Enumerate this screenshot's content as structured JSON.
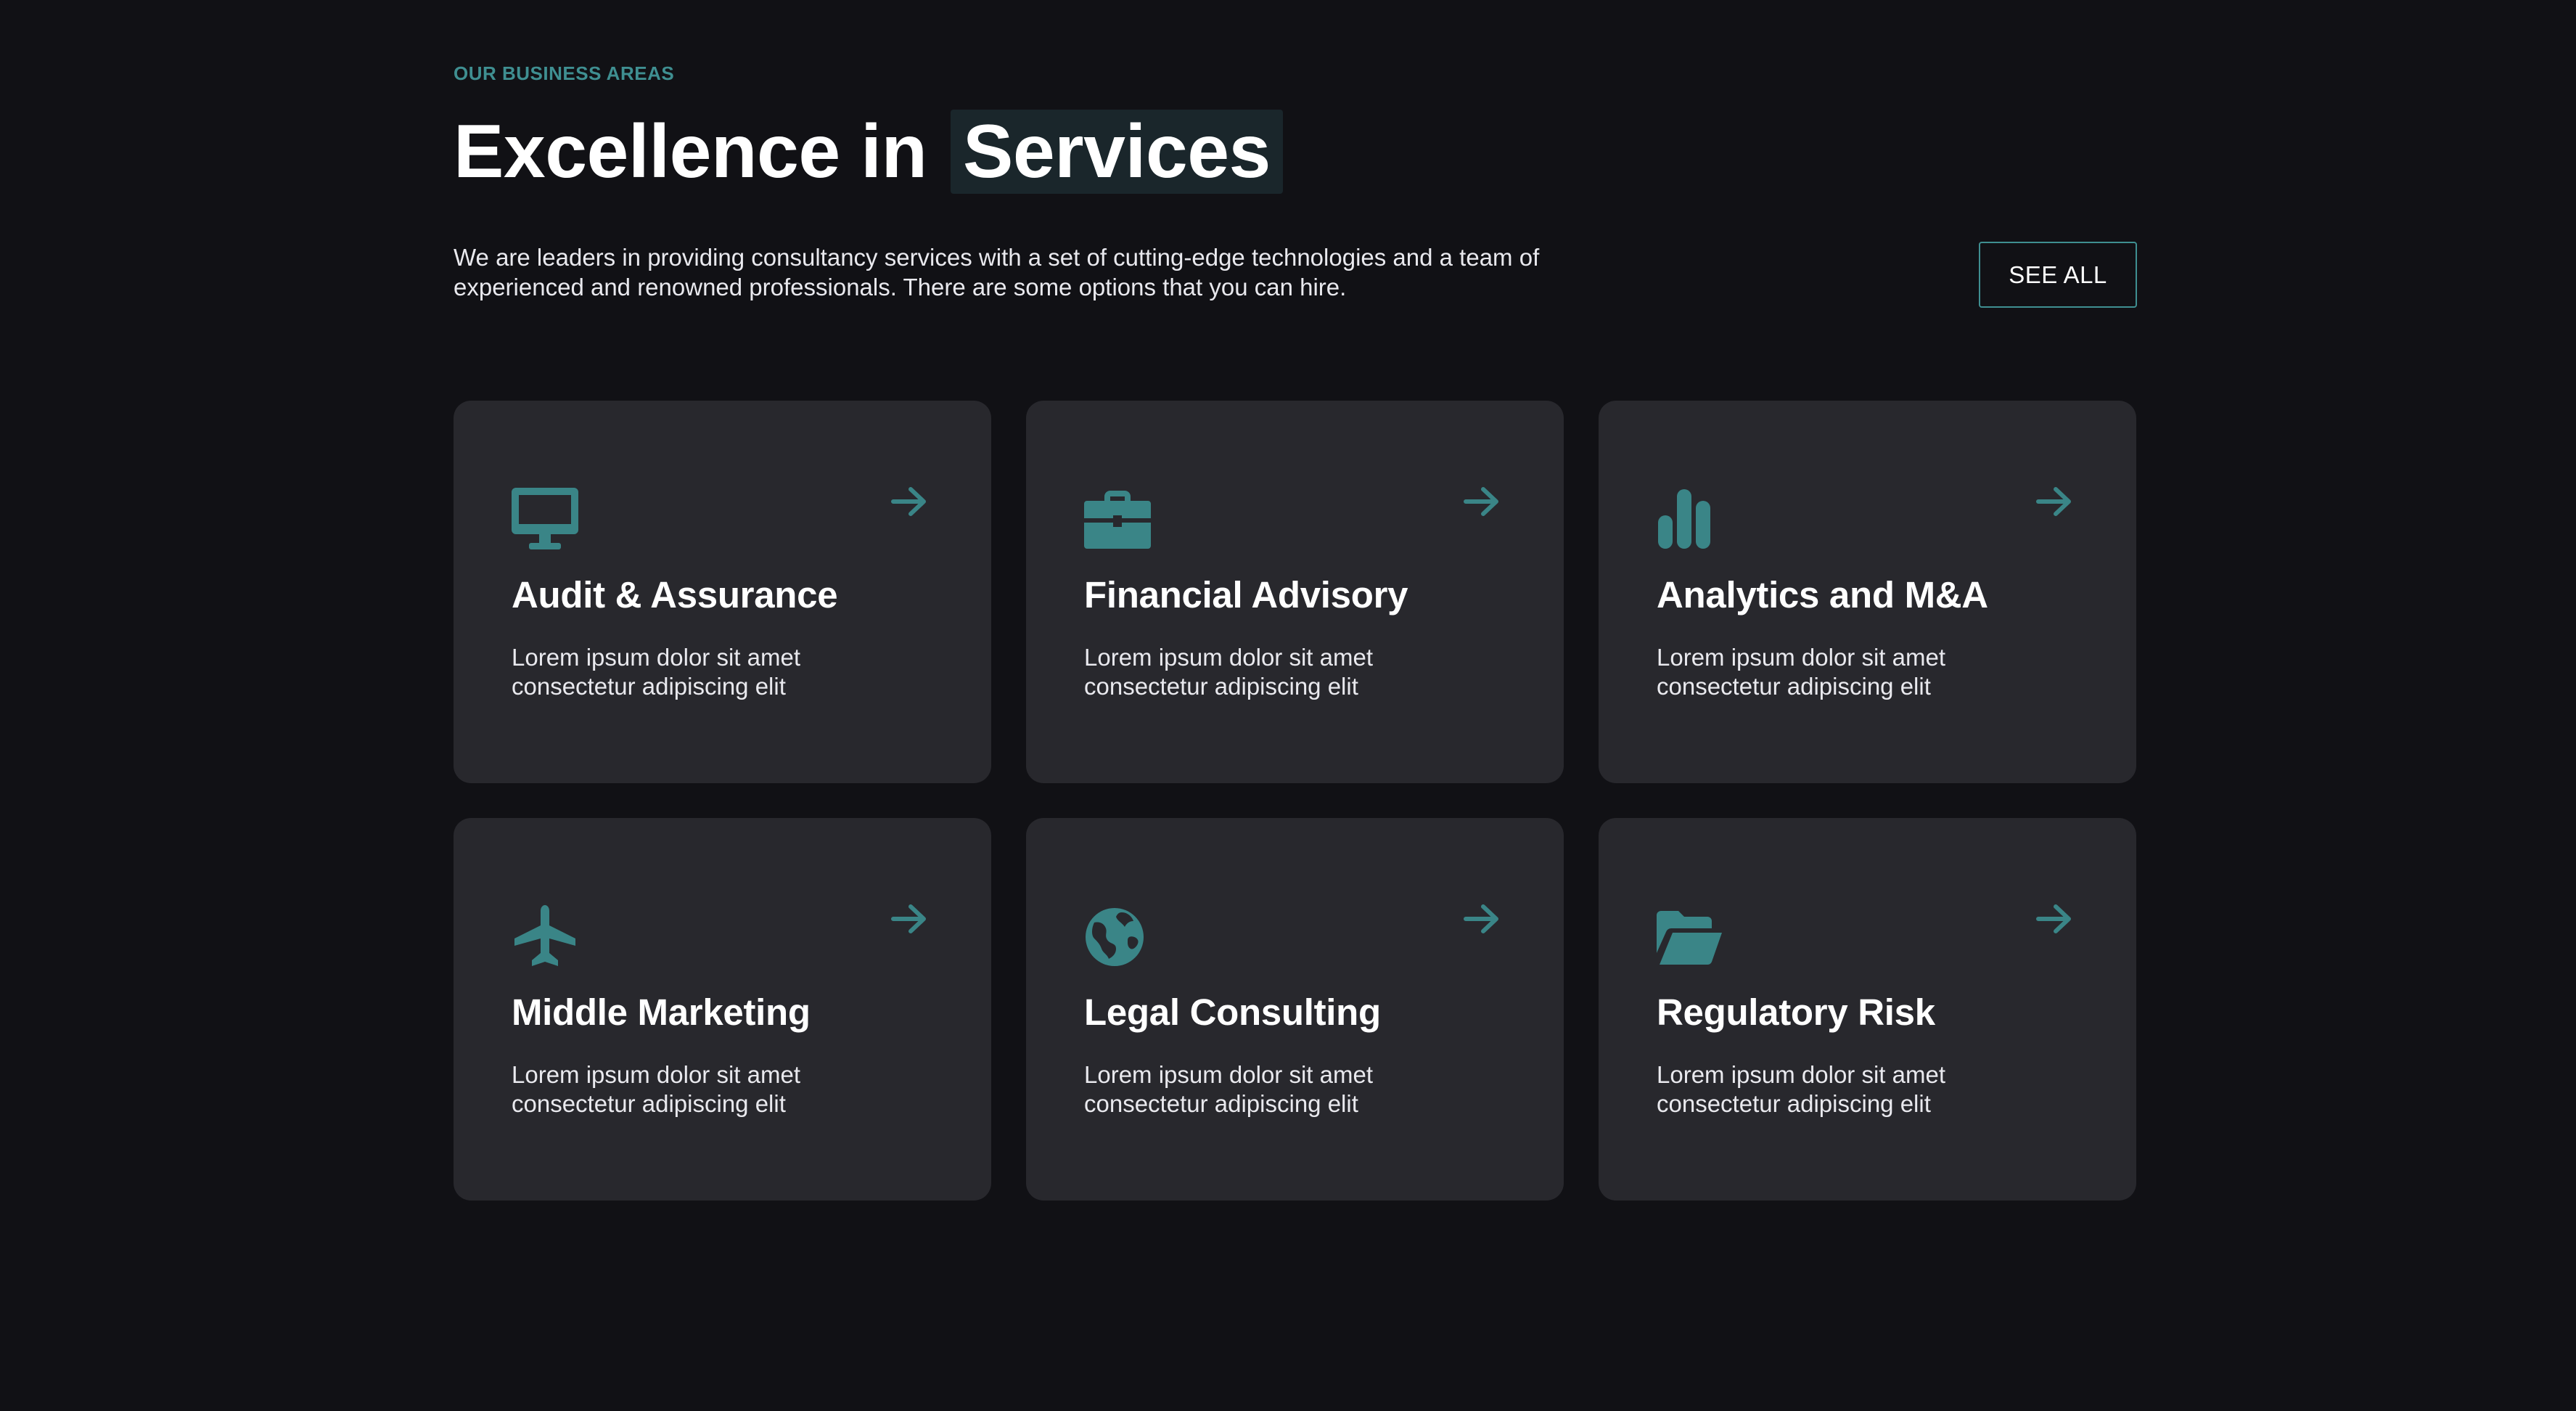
{
  "section": {
    "eyebrow": "OUR BUSINESS AREAS",
    "title_plain": "Excellence in",
    "title_highlight": "Services",
    "intro": "We are leaders in providing consultancy services with a set of cutting-edge technologies and a team of experienced and renowned professionals. There are some options that you can hire.",
    "see_all_label": "SEE ALL"
  },
  "theme": {
    "background": "#111115",
    "card_background": "#28282d",
    "accent": "#3a8587",
    "highlight_background": "#1a262b",
    "text": "#ffffff"
  },
  "cards": [
    {
      "icon": "desktop-icon",
      "title": "Audit & Assurance",
      "description": "Lorem ipsum dolor sit amet consectetur adipiscing elit",
      "arrow_icon": "arrow-right-icon"
    },
    {
      "icon": "briefcase-icon",
      "title": "Financial Advisory",
      "description": "Lorem ipsum dolor sit amet consectetur adipiscing elit",
      "arrow_icon": "arrow-right-icon"
    },
    {
      "icon": "bar-chart-icon",
      "title": "Analytics and M&A",
      "description": "Lorem ipsum dolor sit amet consectetur adipiscing elit",
      "arrow_icon": "arrow-right-icon"
    },
    {
      "icon": "airplane-icon",
      "title": "Middle Marketing",
      "description": "Lorem ipsum dolor sit amet consectetur adipiscing elit",
      "arrow_icon": "arrow-right-icon"
    },
    {
      "icon": "globe-icon",
      "title": "Legal Consulting",
      "description": "Lorem ipsum dolor sit amet consectetur adipiscing elit",
      "arrow_icon": "arrow-right-icon"
    },
    {
      "icon": "folder-open-icon",
      "title": "Regulatory Risk",
      "description": "Lorem ipsum dolor sit amet consectetur adipiscing elit",
      "arrow_icon": "arrow-right-icon"
    }
  ]
}
